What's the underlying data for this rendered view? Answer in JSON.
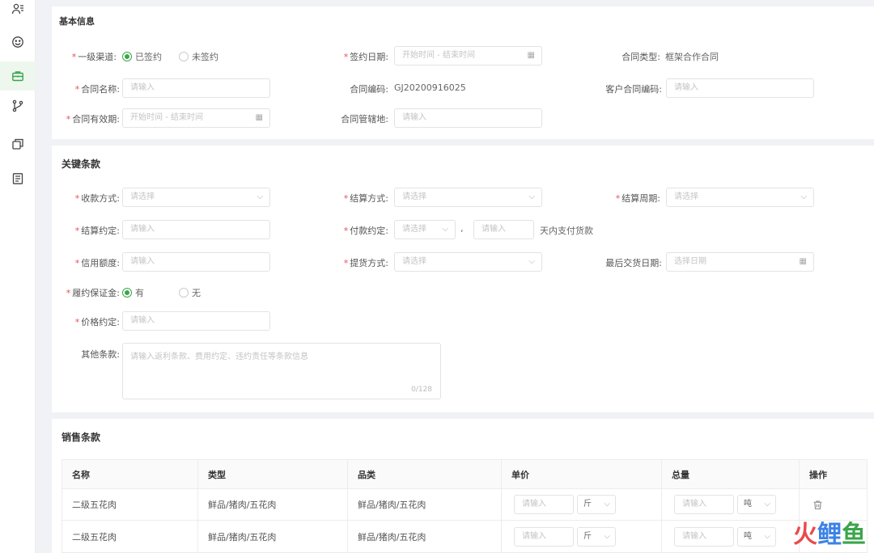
{
  "sidebar": {
    "items": [
      {
        "icon": "user-list-icon"
      },
      {
        "icon": "smiley-icon"
      },
      {
        "icon": "briefcase-icon",
        "active": true
      },
      {
        "icon": "branch-icon"
      },
      {
        "icon": "copy-icon"
      },
      {
        "icon": "document-icon"
      }
    ]
  },
  "basic": {
    "title": "基本信息",
    "channel_label": "一级渠道:",
    "channel_signed": "已签约",
    "channel_unsigned": "未签约",
    "sign_date_label": "签约日期:",
    "sign_date_placeholder": "开始时间 - 结束时间",
    "contract_type_label": "合同类型:",
    "contract_type_value": "框架合作合同",
    "contract_name_label": "合同名称:",
    "contract_name_placeholder": "请输入",
    "contract_code_label": "合同编码:",
    "contract_code_value": "GJ20200916025",
    "customer_code_label": "客户合同编码:",
    "customer_code_placeholder": "请输入",
    "validity_label": "合同有效期:",
    "validity_placeholder": "开始时间 - 结束时间",
    "jurisdiction_label": "合同管辖地:",
    "jurisdiction_placeholder": "请输入"
  },
  "terms": {
    "title": "关键条款",
    "collect_label": "收款方式:",
    "collect_placeholder": "请选择",
    "settle_method_label": "结算方式:",
    "settle_method_placeholder": "请选择",
    "settle_period_label": "结算周期:",
    "settle_period_placeholder": "请选择",
    "settle_agree_label": "结算约定:",
    "settle_agree_placeholder": "请输入",
    "pay_agree_label": "付款约定:",
    "pay_agree_select": "请选择",
    "pay_agree_comma": ",",
    "pay_agree_input": "请输入",
    "pay_agree_suffix": "天内支付货款",
    "credit_label": "信用额度:",
    "credit_placeholder": "请输入",
    "pickup_label": "提货方式:",
    "pickup_placeholder": "请选择",
    "last_delivery_label": "最后交货日期:",
    "last_delivery_placeholder": "选择日期",
    "deposit_label": "履约保证金:",
    "deposit_yes": "有",
    "deposit_no": "无",
    "price_label": "价格约定:",
    "price_placeholder": "请输入",
    "other_label": "其他条款:",
    "other_placeholder": "请输入返利条款、费用约定、违约责任等条款信息",
    "other_counter": "0/128"
  },
  "sales": {
    "title": "销售条款",
    "columns": [
      "名称",
      "类型",
      "品类",
      "单价",
      "总量",
      "操作"
    ],
    "rows": [
      {
        "name": "二级五花肉",
        "type": "鲜品/猪肉/五花肉",
        "category": "鲜品/猪肉/五花肉",
        "price_placeholder": "请输入",
        "price_unit": "斤",
        "qty_placeholder": "请输入",
        "qty_unit": "吨"
      },
      {
        "name": "二级五花肉",
        "type": "鲜品/猪肉/五花肉",
        "category": "鲜品/猪肉/五花肉",
        "price_placeholder": "请输入",
        "price_unit": "斤",
        "qty_placeholder": "请输入",
        "qty_unit": "吨"
      }
    ]
  },
  "watermark": {
    "c1": "火",
    "c2": "鲤",
    "c3": "鱼"
  },
  "chevron": "⌵",
  "calendar": "▦"
}
